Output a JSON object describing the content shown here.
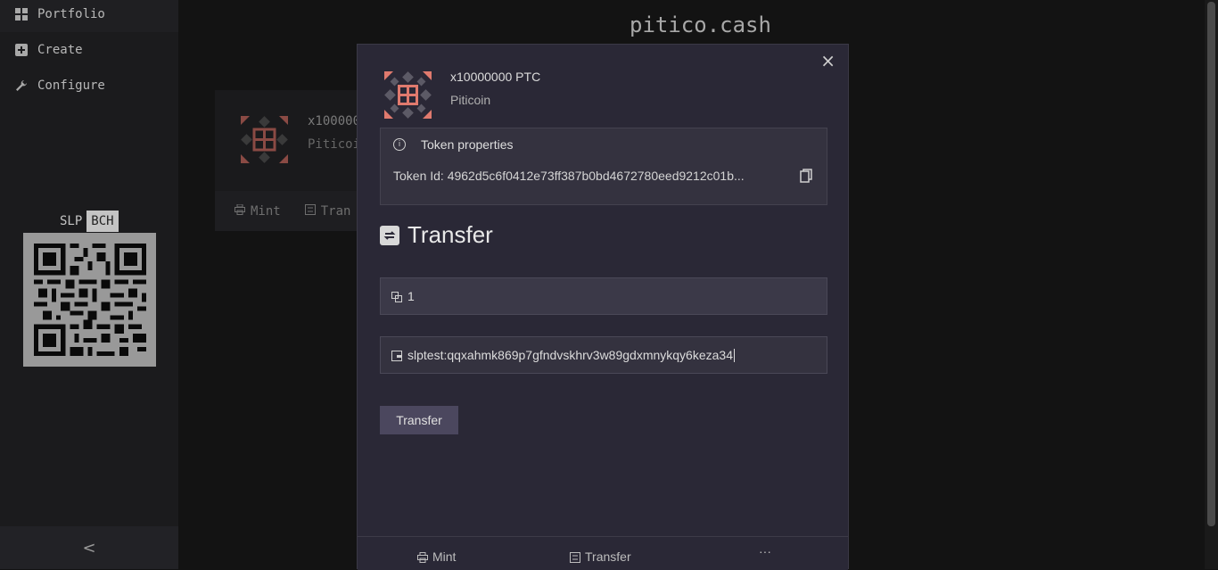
{
  "sidebar": {
    "items": [
      {
        "label": "Portfolio",
        "icon": "grid-icon"
      },
      {
        "label": "Create",
        "icon": "plus-box-icon"
      },
      {
        "label": "Configure",
        "icon": "wrench-icon"
      }
    ],
    "address_tabs": [
      "SLP",
      "BCH"
    ],
    "selected_tab": "BCH",
    "collapse_glyph": "<"
  },
  "site": {
    "title": "pitico.cash"
  },
  "background_card": {
    "title": "x100000",
    "subtitle": "Piticoi",
    "mint_label": "Mint",
    "transfer_label": "Tran"
  },
  "modal": {
    "close_glyph": "×",
    "token_title": "x10000000 PTC",
    "token_name": "Piticoin",
    "props_heading": "Token properties",
    "token_id_label": "Token Id: 4962d5c6f0412e73ff387b0bd4672780eed9212c01b...",
    "section_title": "Transfer",
    "amount_value": "1",
    "address_value": "slptest:qqxahmk869p7gfndvskhrv3w89gdxmnykqy6keza34",
    "submit_label": "Transfer",
    "footer": {
      "mint_label": "Mint",
      "transfer_label": "Transfer",
      "more_glyph": "···"
    }
  },
  "colors": {
    "accent_token": "#e07a6e",
    "modal_bg": "#2a2836",
    "button_bg": "#4b475e"
  }
}
